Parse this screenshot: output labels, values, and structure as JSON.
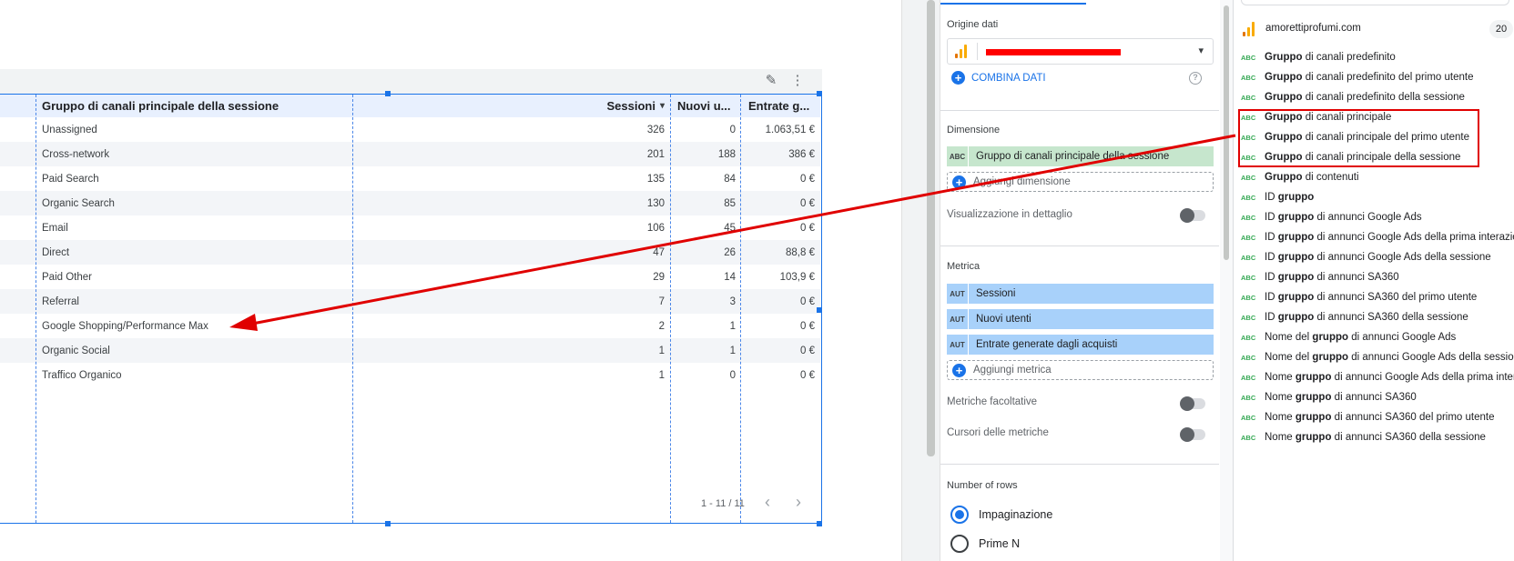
{
  "table": {
    "header": {
      "dimension": "Gruppo di canali principale della sessione",
      "col1": "Sessioni",
      "col1_sort": "▾",
      "col2": "Nuovi u...",
      "col3": "Entrate g..."
    },
    "rows": [
      {
        "label": "Unassigned",
        "v1": "326",
        "v2": "0",
        "v3": "1.063,51 €"
      },
      {
        "label": "Cross-network",
        "v1": "201",
        "v2": "188",
        "v3": "386 €"
      },
      {
        "label": "Paid Search",
        "v1": "135",
        "v2": "84",
        "v3": "0 €"
      },
      {
        "label": "Organic Search",
        "v1": "130",
        "v2": "85",
        "v3": "0 €"
      },
      {
        "label": "Email",
        "v1": "106",
        "v2": "45",
        "v3": "0 €"
      },
      {
        "label": "Direct",
        "v1": "47",
        "v2": "26",
        "v3": "88,8 €"
      },
      {
        "label": "Paid Other",
        "v1": "29",
        "v2": "14",
        "v3": "103,9 €"
      },
      {
        "label": "Referral",
        "v1": "7",
        "v2": "3",
        "v3": "0 €"
      },
      {
        "label": "Google Shopping/Performance Max",
        "v1": "2",
        "v2": "1",
        "v3": "0 €"
      },
      {
        "label": "Organic Social",
        "v1": "1",
        "v2": "1",
        "v3": "0 €"
      },
      {
        "label": "Traffico Organico",
        "v1": "1",
        "v2": "0",
        "v3": "0 €"
      }
    ],
    "pager": "1 - 11 / 11",
    "pager_prev": "‹",
    "pager_next": "›",
    "edit_icon": "✎",
    "more_icon": "⋮"
  },
  "panel": {
    "source_label": "Origine dati",
    "source_caret": "▾",
    "blend_label": "COMBINA DATI",
    "help_icon": "?",
    "dimension_label": "Dimensione",
    "dimension_chip": "Gruppo di canali principale della sessione",
    "dimension_tag": "ABC",
    "add_dimension": "Aggiungi dimensione",
    "drilldown_label": "Visualizzazione in dettaglio",
    "metric_label": "Metrica",
    "metric_tag": "AUT",
    "metrics": [
      "Sessioni",
      "Nuovi utenti",
      "Entrate generate dagli acquisti"
    ],
    "add_metric": "Aggiungi metrica",
    "optional_metrics": "Metriche facoltative",
    "metric_sliders": "Cursori delle metriche",
    "rows_label": "Number of rows",
    "radio_options": [
      "Impaginazione",
      "Prime N"
    ],
    "selected_radio": "Impaginazione"
  },
  "field_list": {
    "source_name": "amorettiprofumi.com",
    "count": "20",
    "type_tag": "ABC",
    "fields": [
      {
        "pre": "",
        "bold": "Gruppo",
        "post": " di canali predefinito"
      },
      {
        "pre": "",
        "bold": "Gruppo",
        "post": " di canali predefinito del primo utente"
      },
      {
        "pre": "",
        "bold": "Gruppo",
        "post": " di canali predefinito della sessione"
      },
      {
        "pre": "",
        "bold": "Gruppo",
        "post": " di canali principale"
      },
      {
        "pre": "",
        "bold": "Gruppo",
        "post": " di canali principale del primo utente"
      },
      {
        "pre": "",
        "bold": "Gruppo",
        "post": " di canali principale della sessione"
      },
      {
        "pre": "",
        "bold": "Gruppo",
        "post": " di contenuti"
      },
      {
        "pre": "ID ",
        "bold": "gruppo",
        "post": ""
      },
      {
        "pre": "ID ",
        "bold": "gruppo",
        "post": " di annunci Google Ads"
      },
      {
        "pre": "ID ",
        "bold": "gruppo",
        "post": " di annunci Google Ads della prima interazio…"
      },
      {
        "pre": "ID ",
        "bold": "gruppo",
        "post": " di annunci Google Ads della sessione"
      },
      {
        "pre": "ID ",
        "bold": "gruppo",
        "post": " di annunci SA360"
      },
      {
        "pre": "ID ",
        "bold": "gruppo",
        "post": " di annunci SA360 del primo utente"
      },
      {
        "pre": "ID ",
        "bold": "gruppo",
        "post": " di annunci SA360 della sessione"
      },
      {
        "pre": "Nome del ",
        "bold": "gruppo",
        "post": " di annunci Google Ads"
      },
      {
        "pre": "Nome del ",
        "bold": "gruppo",
        "post": " di annunci Google Ads della sessione"
      },
      {
        "pre": "Nome ",
        "bold": "gruppo",
        "post": " di annunci Google Ads della prima inter…"
      },
      {
        "pre": "Nome ",
        "bold": "gruppo",
        "post": " di annunci SA360"
      },
      {
        "pre": "Nome ",
        "bold": "gruppo",
        "post": " di annunci SA360 del primo utente"
      },
      {
        "pre": "Nome ",
        "bold": "gruppo",
        "post": " di annunci SA360 della sessione"
      }
    ]
  },
  "colors": {
    "accent": "#1a73e8",
    "dimension_chip": "#c6e6cd",
    "metric_chip": "#a8d1fa",
    "annotation": "#e00000",
    "ga_orange": "#f9ab00",
    "ga_dark_orange": "#e37400"
  }
}
